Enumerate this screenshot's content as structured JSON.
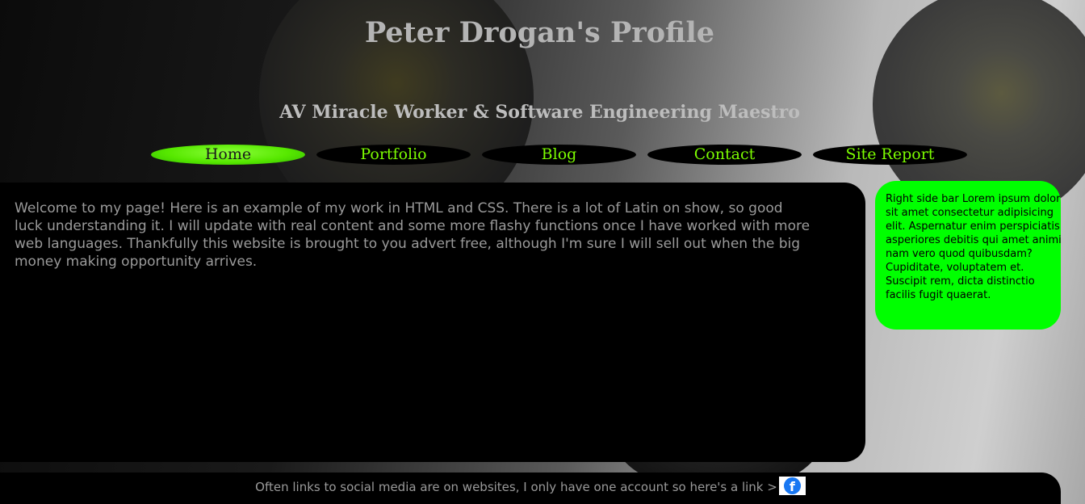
{
  "header": {
    "title": "Peter Drogan's Profile",
    "subtitle": "AV Miracle Worker & Software Engineering Maestro"
  },
  "nav": {
    "items": [
      {
        "label": "Home",
        "active": true
      },
      {
        "label": "Portfolio",
        "active": false
      },
      {
        "label": "Blog",
        "active": false
      },
      {
        "label": "Contact",
        "active": false
      },
      {
        "label": "Site Report",
        "active": false
      }
    ]
  },
  "main": {
    "text": "Welcome to my page! Here is an example of my work in HTML and CSS. There is a lot of Latin on show, so good luck understanding it. I will update with real content and some more flashy functions once I have worked with more web languages. Thankfully this website is brought to you advert free, although I'm sure I will sell out when the big money making opportunity arrives."
  },
  "sidebar": {
    "text": "Right side bar Lorem ipsum dolor sit amet consectetur adipisicing elit. Aspernatur enim perspiciatis asperiores debitis qui amet animi nam vero quod quibusdam? Cupiditate, voluptatem et. Suscipit rem, dicta distinctio facilis fugit quaerat."
  },
  "footer": {
    "text": "Often links to social media are on websites, I only have one account so here's a link >",
    "social_icon": "facebook-icon",
    "social_icon_glyph": "f"
  },
  "colors": {
    "accent": "#7cfc00",
    "sidebar_bg": "#00ff00",
    "panel_bg": "#000000",
    "facebook_blue": "#1877f2"
  }
}
